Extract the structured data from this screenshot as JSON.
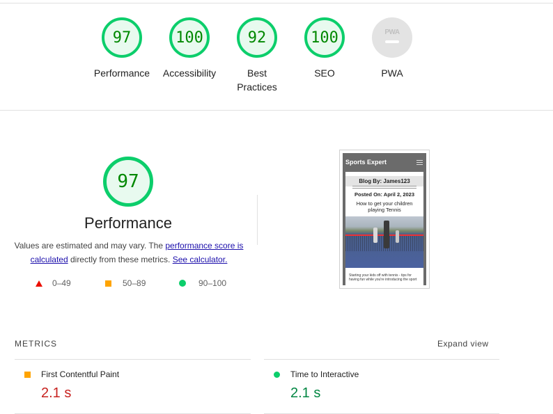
{
  "categories": [
    {
      "score": "97",
      "label": "Performance",
      "color": "#0cce6b"
    },
    {
      "score": "100",
      "label": "Accessibility",
      "color": "#0cce6b"
    },
    {
      "score": "92",
      "label": "Best Practices",
      "color": "#0cce6b"
    },
    {
      "score": "100",
      "label": "SEO",
      "color": "#0cce6b"
    },
    {
      "score": "PWA",
      "label": "PWA",
      "color": "#e3e3e3"
    }
  ],
  "performance": {
    "score": "97",
    "title": "Performance",
    "desc_prefix": "Values are estimated and may vary. The ",
    "link_perf_score": "performance score is calculated",
    "desc_middle": " directly from these metrics. ",
    "link_calculator": "See calculator."
  },
  "legend": {
    "fail": "0–49",
    "average": "50–89",
    "pass": "90–100"
  },
  "screenshot": {
    "site_title": "Sports Expert",
    "blog_by": "Blog By: James123",
    "posted_on": "Posted On: April 2, 2023",
    "headline": "How to get your children playing Tennis",
    "snippet": "Starting your kids off with tennis - tips for having fun while you're introducing the sport"
  },
  "metrics": {
    "title": "METRICS",
    "expand_label": "Expand view",
    "items": [
      {
        "name": "First Contentful Paint",
        "value": "2.1 s",
        "status": "average",
        "value_color": "#c7221f"
      },
      {
        "name": "Time to Interactive",
        "value": "2.1 s",
        "status": "pass",
        "value_color": "#018642"
      }
    ]
  }
}
